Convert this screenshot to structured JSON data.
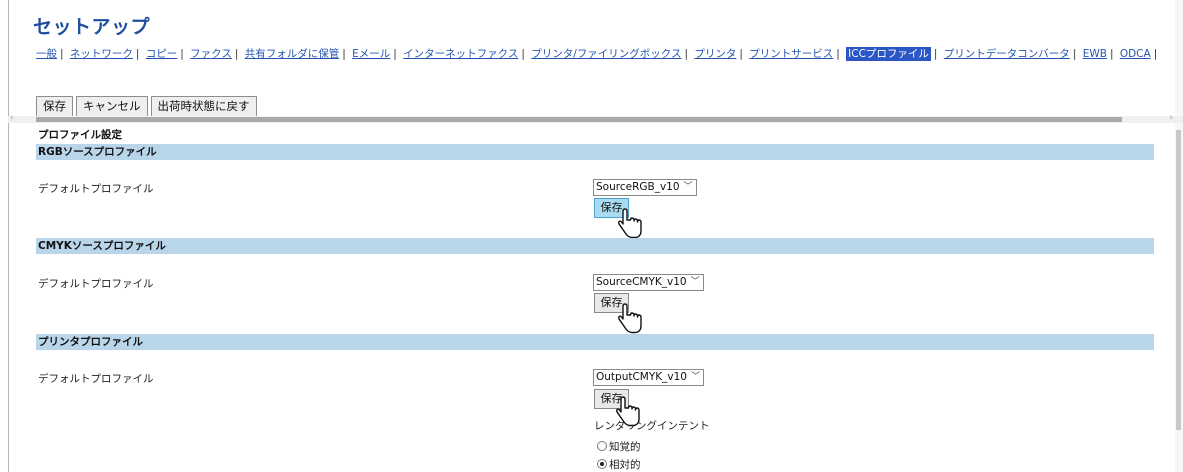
{
  "page": {
    "title": "セットアップ"
  },
  "nav": {
    "items": [
      {
        "label": "一般"
      },
      {
        "label": "ネットワーク"
      },
      {
        "label": "コピー"
      },
      {
        "label": "ファクス"
      },
      {
        "label": "共有フォルダに保管"
      },
      {
        "label": "Eメール"
      },
      {
        "label": "インターネットファクス"
      },
      {
        "label": "プリンタ/ファイリングボックス"
      },
      {
        "label": "プリンタ"
      },
      {
        "label": "プリントサービス"
      },
      {
        "label": "ICCプロファイル",
        "active": true
      },
      {
        "label": "プリントデータコンバータ"
      },
      {
        "label": "EWB"
      },
      {
        "label": "ODCA"
      }
    ]
  },
  "toolbar": {
    "save": "保存",
    "cancel": "キャンセル",
    "reset": "出荷時状態に戻す"
  },
  "profile_settings_title": "プロファイル設定",
  "sections": [
    {
      "header": "RGBソースプロファイル",
      "label": "デフォルトプロファイル",
      "selected": "SourceRGB_v10",
      "save": "保存"
    },
    {
      "header": "CMYKソースプロファイル",
      "label": "デフォルトプロファイル",
      "selected": "SourceCMYK_v10",
      "save": "保存"
    },
    {
      "header": "プリンタプロファイル",
      "label": "デフォルトプロファイル",
      "selected": "OutputCMYK_v10",
      "save": "保存",
      "rendering_intent_label": "レンダリングインテント",
      "rendering_options": [
        {
          "label": "知覚的",
          "checked": false
        },
        {
          "label": "相対的",
          "checked": true
        }
      ]
    }
  ],
  "colors": {
    "title": "#1e4f9c",
    "link": "#2554b0",
    "active_tab": "#2a56c6",
    "section_bar": "#b9d5ea",
    "hover_button": "#a9dcf2"
  },
  "icons": {
    "cursor": "hand-pointer-icon",
    "select": "chevron-down-icon"
  }
}
